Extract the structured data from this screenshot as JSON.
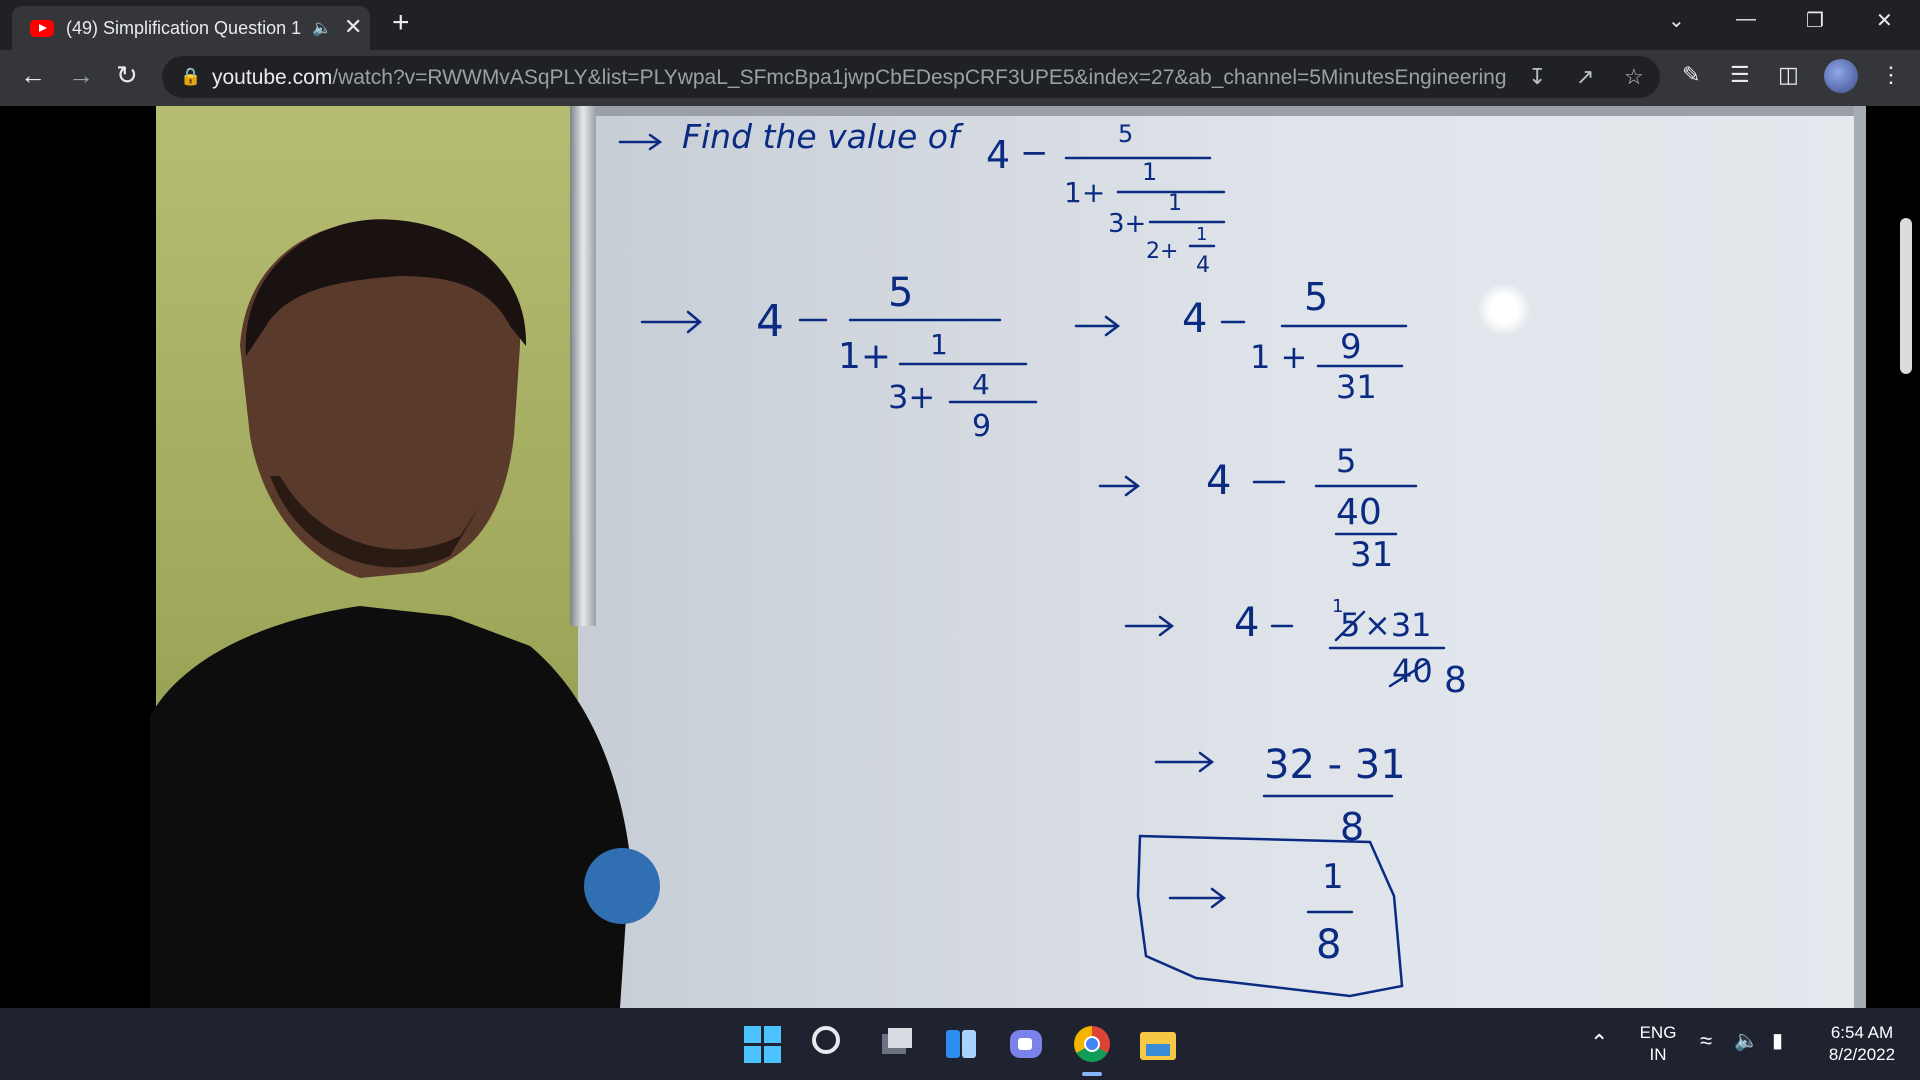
{
  "browser": {
    "tab": {
      "title": "(49) Simplification Question 1",
      "favicon": "youtube-icon",
      "audio_icon": "speaker-icon"
    },
    "address_bar": {
      "host": "youtube.com",
      "path": "/watch?v=RWWMvASqPLY&list=PLYwpaL_SFmcBpa1jwpCbEDespCRF3UPE5&index=27&ab_channel=5MinutesEngineering"
    }
  },
  "whiteboard": {
    "heading": "Find the value of",
    "problem": {
      "whole": "4",
      "minus": "−",
      "n1": "5",
      "d1_whole": "1+",
      "n2": "1",
      "d2_whole": "3+",
      "n3": "1",
      "d3_whole": "2+",
      "n4": "1",
      "d4": "4"
    },
    "step1": {
      "whole": "4",
      "n1": "5",
      "d1_whole": "1+",
      "n2": "1",
      "d2_whole": "3+",
      "n3": "4",
      "d3": "9"
    },
    "step2": {
      "whole": "4",
      "n1": "5",
      "d1_whole": "1 +",
      "n2": "9",
      "d2": "31"
    },
    "step3": {
      "whole": "4",
      "n1": "5",
      "n2": "40",
      "d2": "31"
    },
    "step4": {
      "whole": "4",
      "cancelled_num": "5",
      "num_rest": "×31",
      "small_one": "1",
      "cancelled_den": "40",
      "den": "8"
    },
    "step5": {
      "numerator": "32 - 31",
      "denominator": "8"
    },
    "answer": {
      "numerator": "1",
      "denominator": "8"
    }
  },
  "taskbar": {
    "apps": [
      "windows-start-icon",
      "search-icon",
      "task-view-icon",
      "widgets-icon",
      "teams-chat-icon",
      "chrome-icon",
      "file-explorer-icon"
    ],
    "language": "ENG",
    "region": "IN",
    "time": "6:54 AM",
    "date": "8/2/2022"
  },
  "colors": {
    "ink": "#0b2b83",
    "board": "#e2e7ec",
    "tabbar": "#202124",
    "toolbar": "#35363a",
    "taskbar": "#1f2330"
  }
}
